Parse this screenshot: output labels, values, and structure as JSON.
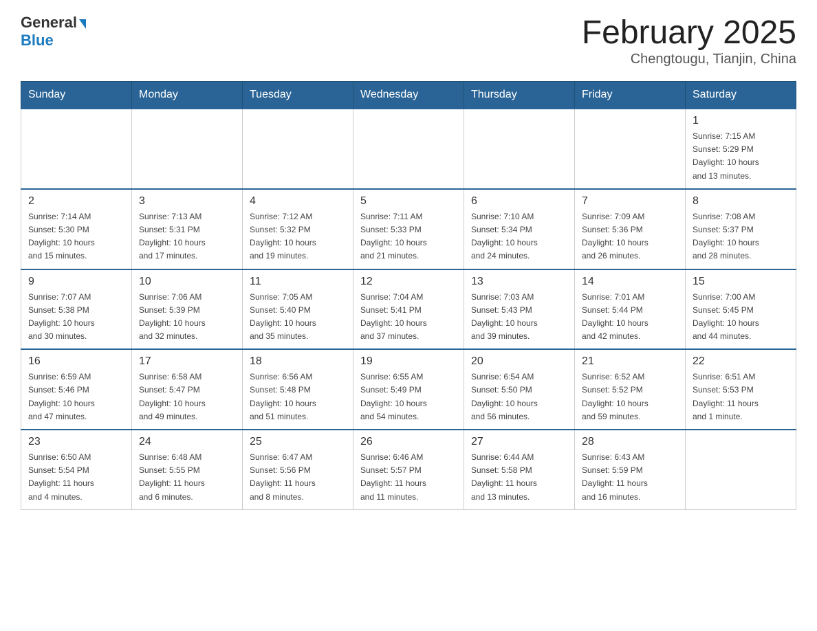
{
  "header": {
    "logo": {
      "general": "General",
      "blue": "Blue"
    },
    "title": "February 2025",
    "subtitle": "Chengtougu, Tianjin, China"
  },
  "days_of_week": [
    "Sunday",
    "Monday",
    "Tuesday",
    "Wednesday",
    "Thursday",
    "Friday",
    "Saturday"
  ],
  "weeks": [
    [
      {
        "day": "",
        "info": ""
      },
      {
        "day": "",
        "info": ""
      },
      {
        "day": "",
        "info": ""
      },
      {
        "day": "",
        "info": ""
      },
      {
        "day": "",
        "info": ""
      },
      {
        "day": "",
        "info": ""
      },
      {
        "day": "1",
        "info": "Sunrise: 7:15 AM\nSunset: 5:29 PM\nDaylight: 10 hours\nand 13 minutes."
      }
    ],
    [
      {
        "day": "2",
        "info": "Sunrise: 7:14 AM\nSunset: 5:30 PM\nDaylight: 10 hours\nand 15 minutes."
      },
      {
        "day": "3",
        "info": "Sunrise: 7:13 AM\nSunset: 5:31 PM\nDaylight: 10 hours\nand 17 minutes."
      },
      {
        "day": "4",
        "info": "Sunrise: 7:12 AM\nSunset: 5:32 PM\nDaylight: 10 hours\nand 19 minutes."
      },
      {
        "day": "5",
        "info": "Sunrise: 7:11 AM\nSunset: 5:33 PM\nDaylight: 10 hours\nand 21 minutes."
      },
      {
        "day": "6",
        "info": "Sunrise: 7:10 AM\nSunset: 5:34 PM\nDaylight: 10 hours\nand 24 minutes."
      },
      {
        "day": "7",
        "info": "Sunrise: 7:09 AM\nSunset: 5:36 PM\nDaylight: 10 hours\nand 26 minutes."
      },
      {
        "day": "8",
        "info": "Sunrise: 7:08 AM\nSunset: 5:37 PM\nDaylight: 10 hours\nand 28 minutes."
      }
    ],
    [
      {
        "day": "9",
        "info": "Sunrise: 7:07 AM\nSunset: 5:38 PM\nDaylight: 10 hours\nand 30 minutes."
      },
      {
        "day": "10",
        "info": "Sunrise: 7:06 AM\nSunset: 5:39 PM\nDaylight: 10 hours\nand 32 minutes."
      },
      {
        "day": "11",
        "info": "Sunrise: 7:05 AM\nSunset: 5:40 PM\nDaylight: 10 hours\nand 35 minutes."
      },
      {
        "day": "12",
        "info": "Sunrise: 7:04 AM\nSunset: 5:41 PM\nDaylight: 10 hours\nand 37 minutes."
      },
      {
        "day": "13",
        "info": "Sunrise: 7:03 AM\nSunset: 5:43 PM\nDaylight: 10 hours\nand 39 minutes."
      },
      {
        "day": "14",
        "info": "Sunrise: 7:01 AM\nSunset: 5:44 PM\nDaylight: 10 hours\nand 42 minutes."
      },
      {
        "day": "15",
        "info": "Sunrise: 7:00 AM\nSunset: 5:45 PM\nDaylight: 10 hours\nand 44 minutes."
      }
    ],
    [
      {
        "day": "16",
        "info": "Sunrise: 6:59 AM\nSunset: 5:46 PM\nDaylight: 10 hours\nand 47 minutes."
      },
      {
        "day": "17",
        "info": "Sunrise: 6:58 AM\nSunset: 5:47 PM\nDaylight: 10 hours\nand 49 minutes."
      },
      {
        "day": "18",
        "info": "Sunrise: 6:56 AM\nSunset: 5:48 PM\nDaylight: 10 hours\nand 51 minutes."
      },
      {
        "day": "19",
        "info": "Sunrise: 6:55 AM\nSunset: 5:49 PM\nDaylight: 10 hours\nand 54 minutes."
      },
      {
        "day": "20",
        "info": "Sunrise: 6:54 AM\nSunset: 5:50 PM\nDaylight: 10 hours\nand 56 minutes."
      },
      {
        "day": "21",
        "info": "Sunrise: 6:52 AM\nSunset: 5:52 PM\nDaylight: 10 hours\nand 59 minutes."
      },
      {
        "day": "22",
        "info": "Sunrise: 6:51 AM\nSunset: 5:53 PM\nDaylight: 11 hours\nand 1 minute."
      }
    ],
    [
      {
        "day": "23",
        "info": "Sunrise: 6:50 AM\nSunset: 5:54 PM\nDaylight: 11 hours\nand 4 minutes."
      },
      {
        "day": "24",
        "info": "Sunrise: 6:48 AM\nSunset: 5:55 PM\nDaylight: 11 hours\nand 6 minutes."
      },
      {
        "day": "25",
        "info": "Sunrise: 6:47 AM\nSunset: 5:56 PM\nDaylight: 11 hours\nand 8 minutes."
      },
      {
        "day": "26",
        "info": "Sunrise: 6:46 AM\nSunset: 5:57 PM\nDaylight: 11 hours\nand 11 minutes."
      },
      {
        "day": "27",
        "info": "Sunrise: 6:44 AM\nSunset: 5:58 PM\nDaylight: 11 hours\nand 13 minutes."
      },
      {
        "day": "28",
        "info": "Sunrise: 6:43 AM\nSunset: 5:59 PM\nDaylight: 11 hours\nand 16 minutes."
      },
      {
        "day": "",
        "info": ""
      }
    ]
  ]
}
